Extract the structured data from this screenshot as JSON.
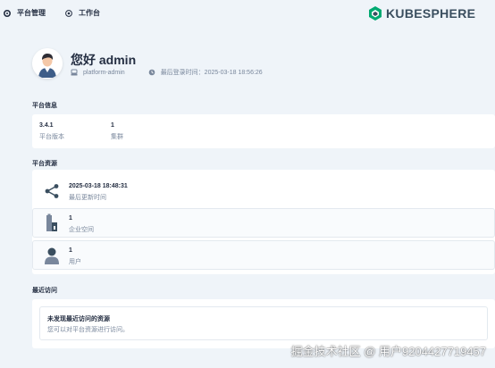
{
  "topbar": {
    "platform_label": "平台管理",
    "workbench_label": "工作台",
    "logo_text": "KUBESPHERE",
    "brand_color": "#00a971"
  },
  "welcome": {
    "greeting": "您好 admin",
    "role": "platform-admin",
    "last_login": "最后登录时间：2025-03-18 18:56:26"
  },
  "platform_info": {
    "title": "平台信息",
    "stats": [
      {
        "value": "3.4.1",
        "label": "平台版本"
      },
      {
        "value": "1",
        "label": "集群"
      }
    ]
  },
  "platform_resources": {
    "title": "平台资源",
    "rows": [
      {
        "icon": "share-nodes-icon",
        "value": "2025-03-18 18:48:31",
        "label": "最后更新时间"
      },
      {
        "icon": "enterprise-space-icon",
        "value": "1",
        "label": "企业空间"
      },
      {
        "icon": "user-icon",
        "value": "1",
        "label": "用户"
      }
    ]
  },
  "recent_visits": {
    "title": "最近访问",
    "empty_title": "未发现最近访问的资源",
    "empty_desc": "您可以对平台资源进行访问。"
  },
  "watermark": "掘金技术社区 @ 用户9204427719457"
}
